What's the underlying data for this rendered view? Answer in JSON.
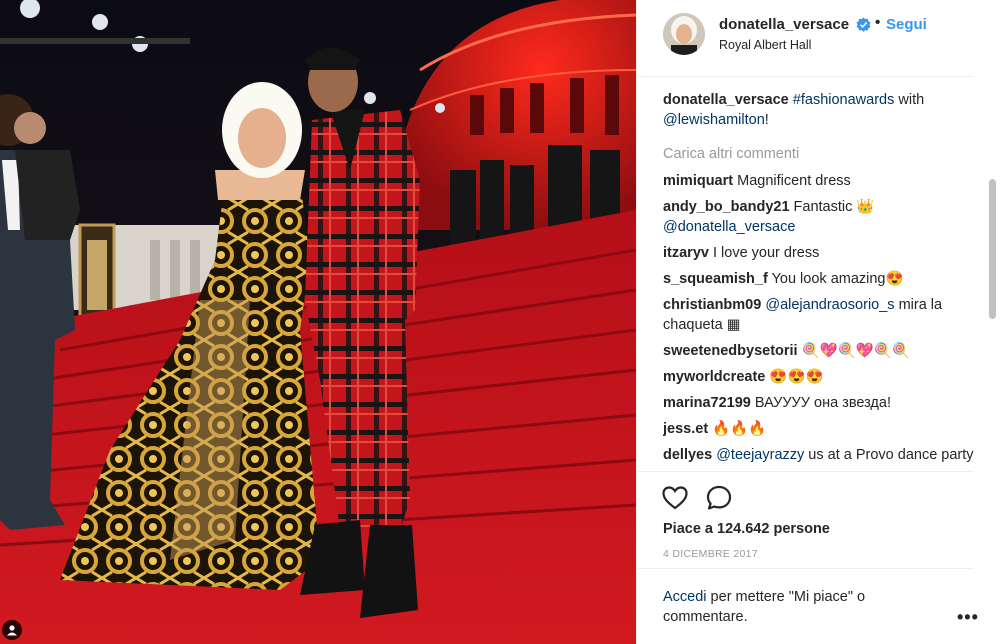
{
  "header": {
    "username": "donatella_versace",
    "follow_label": "Segui",
    "location": "Royal Albert Hall",
    "dot": "•"
  },
  "caption": {
    "username": "donatella_versace",
    "hashtag": "#fashionawards",
    "text_mid": " with ",
    "mention": "@lewishamilton",
    "text_end": "!"
  },
  "load_more": "Carica altri commenti",
  "comments": [
    {
      "user": "mimiquart",
      "pre": "Magnificent dress",
      "mention": "",
      "post": ""
    },
    {
      "user": "andy_bo_bandy21",
      "pre": "Fantastic 👑",
      "mention": "@donatella_versace",
      "post": ""
    },
    {
      "user": "itzaryv",
      "pre": "I love your dress",
      "mention": "",
      "post": ""
    },
    {
      "user": "s_squeamish_f",
      "pre": "You look amazing😍",
      "mention": "",
      "post": ""
    },
    {
      "user": "christianbm09",
      "pre": "",
      "mention": "@alejandraosorio_s",
      "post": " mira la chaqueta ▦"
    },
    {
      "user": "sweetenedbysetorii",
      "pre": "🍭💖🍭💖🍭🍭",
      "mention": "",
      "post": ""
    },
    {
      "user": "myworldcreate",
      "pre": "😍😍😍",
      "mention": "",
      "post": ""
    },
    {
      "user": "marina72199",
      "pre": "ВАУУУУ она звезда!",
      "mention": "",
      "post": ""
    },
    {
      "user": "jess.et",
      "pre": "🔥🔥🔥",
      "mention": "",
      "post": ""
    },
    {
      "user": "dellyes",
      "pre": "",
      "mention": "@teejayrazzy",
      "post": " us at a Provo dance party"
    }
  ],
  "likes": "Piace a 124.642 persone",
  "date": "4 DICEMBRE 2017",
  "login": {
    "link": "Accedi",
    "text": " per mettere \"Mi piace\" o commentare."
  },
  "more_label": "•••",
  "icons": {
    "heart": "heart-icon",
    "comment": "comment-icon",
    "verified": "verified-badge-icon",
    "user_tag": "user-tag-icon"
  },
  "colors": {
    "link_blue": "#3897f0",
    "mention_blue": "#003569",
    "muted": "#999999",
    "carpet_red": "#c0131b"
  }
}
